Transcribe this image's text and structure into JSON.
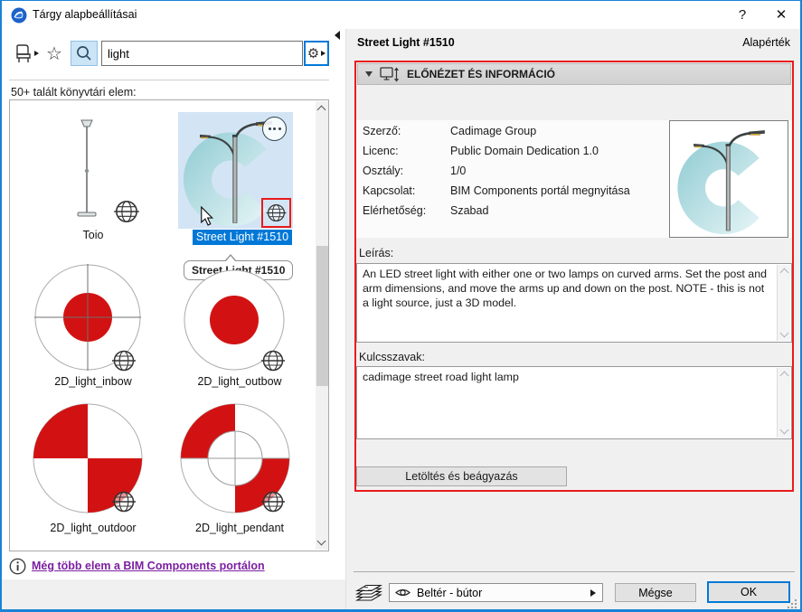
{
  "titlebar": {
    "title": "Tárgy alapbeállításai",
    "help": "?",
    "close": "✕"
  },
  "search": {
    "query": "light",
    "results_label": "50+ talált könyvtári elem:"
  },
  "library": {
    "items": [
      {
        "label": "Toio"
      },
      {
        "label": "Street Light #1510"
      },
      {
        "label": "2D_light_inbow"
      },
      {
        "label": "2D_light_outbow"
      },
      {
        "label": "2D_light_outdoor"
      },
      {
        "label": "2D_light_pendant"
      }
    ],
    "tooltip": "Street Light #1510",
    "more_link": "Még több elem a BIM Components portálon"
  },
  "details": {
    "title": "Street Light #1510",
    "mode": "Alapérték",
    "section_title": "ELŐNÉZET ÉS INFORMÁCIÓ",
    "fields": [
      {
        "label": "Szerző:",
        "value": "Cadimage Group"
      },
      {
        "label": "Licenc:",
        "value": "Public Domain Dedication 1.0"
      },
      {
        "label": "Osztály:",
        "value": "1/0"
      },
      {
        "label": "Kapcsolat:",
        "value": "BIM Components portál megnyitása"
      },
      {
        "label": "Elérhetőség:",
        "value": "Szabad"
      }
    ],
    "description_label": "Leírás:",
    "description": "An LED street light with either one or two lamps on curved arms. Set the post and arm dimensions, and move the arms up and down on the post. NOTE - this is not a light source, just a 3D model.",
    "keywords_label": "Kulcsszavak:",
    "keywords": "cadimage street road light lamp",
    "download_button": "Letöltés és beágyazás"
  },
  "footer": {
    "layer_combo_value": "Beltér - bútor",
    "cancel_label": "Mégse",
    "ok_label": "OK"
  },
  "colors": {
    "accent_blue": "#0078d7",
    "annotation_red": "#e81c1c",
    "symbol_red": "#d21212",
    "link_purple": "#7b1fa2",
    "thumb_blue": "#d3e4f4",
    "logo_teal": "#9fd3da"
  }
}
